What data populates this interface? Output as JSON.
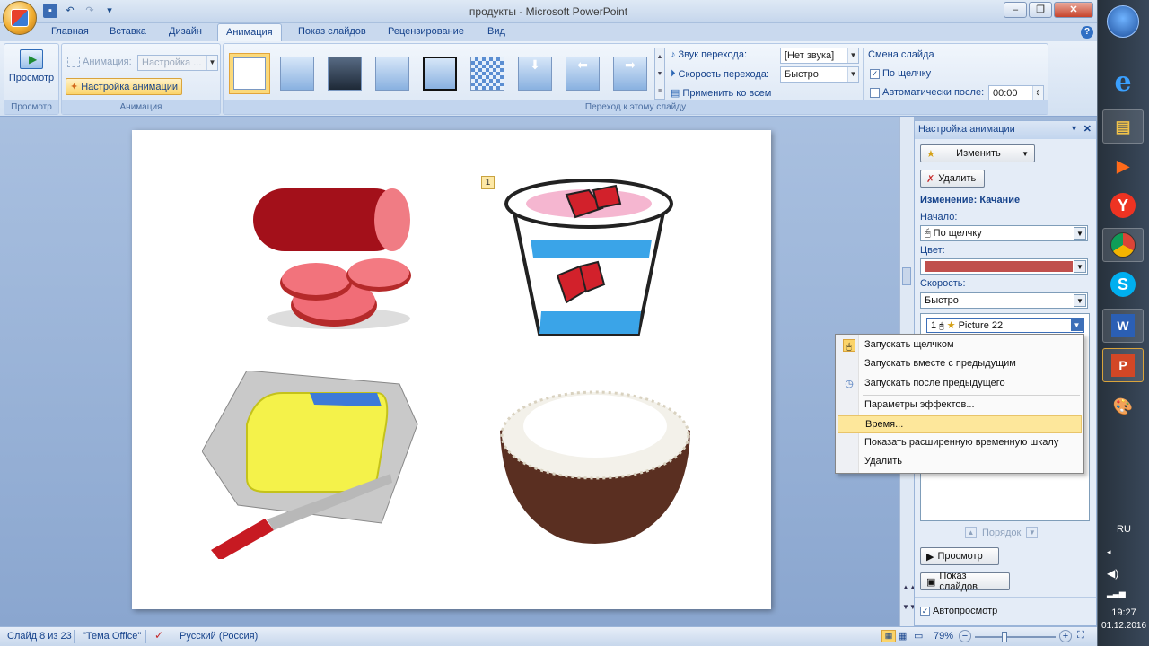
{
  "window": {
    "title": "продукты - Microsoft PowerPoint"
  },
  "ribbon_tabs": [
    "Главная",
    "Вставка",
    "Дизайн",
    "Анимация",
    "Показ слайдов",
    "Рецензирование",
    "Вид"
  ],
  "ribbon": {
    "preview": {
      "button": "Просмотр",
      "group": "Просмотр"
    },
    "animation": {
      "animate_label": "Анимация:",
      "animate_value": "Настройка ...",
      "custom_button": "Настройка анимации",
      "group": "Анимация"
    },
    "transition": {
      "sound_label": "Звук перехода:",
      "sound_value": "[Нет звука]",
      "speed_label": "Скорость перехода:",
      "speed_value": "Быстро",
      "apply_all": "Применить ко всем",
      "advance_title": "Смена слайда",
      "on_click": "По щелчку",
      "auto_after": "Автоматически после:",
      "auto_value": "00:00",
      "group": "Переход к этому слайду"
    }
  },
  "slide": {
    "animation_marker": "1"
  },
  "task_pane": {
    "title": "Настройка анимации",
    "change_button": "Изменить",
    "remove_button": "Удалить",
    "effect_heading": "Изменение: Качание",
    "start_label": "Начало:",
    "start_value": "По щелчку",
    "color_label": "Цвет:",
    "color_swatch": "#c0504d",
    "speed_label": "Скорость:",
    "speed_value": "Быстро",
    "list_item": {
      "num": "1",
      "name": "Picture 22"
    },
    "order_label": "Порядок",
    "play_button": "Просмотр",
    "slideshow_button": "Показ слайдов",
    "autopreview": "Автопросмотр"
  },
  "context_menu": {
    "items": [
      "Запускать щелчком",
      "Запускать вместе с предыдущим",
      "Запускать после предыдущего",
      "Параметры эффектов...",
      "Время...",
      "Показать расширенную временную шкалу",
      "Удалить"
    ]
  },
  "status": {
    "slide": "Слайд 8 из 23",
    "theme": "\"Тема Office\"",
    "language": "Русский (Россия)",
    "zoom": "79%"
  },
  "taskbar": {
    "lang": "RU",
    "time": "19:27",
    "date": "01.12.2016"
  }
}
